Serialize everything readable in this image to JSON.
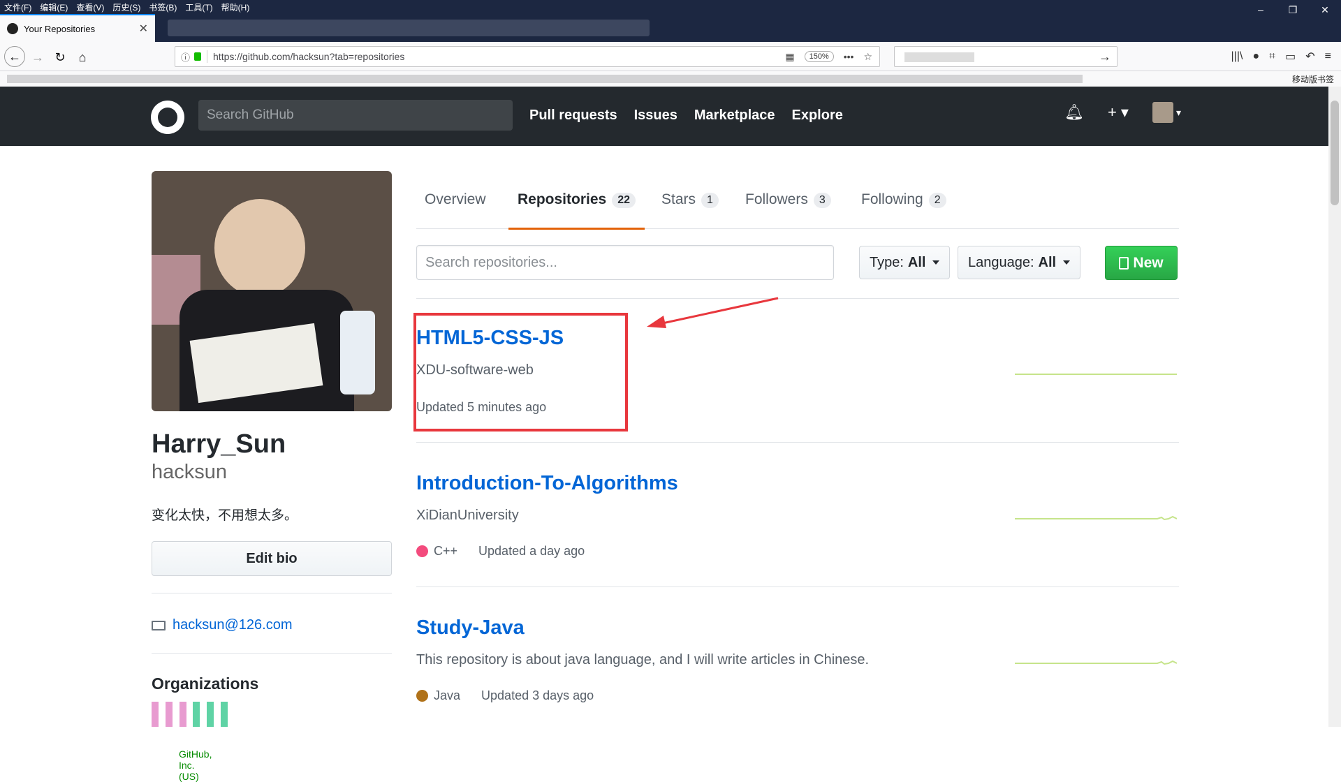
{
  "browser": {
    "menu": [
      "文件(F)",
      "编辑(E)",
      "查看(V)",
      "历史(S)",
      "书签(B)",
      "工具(T)",
      "帮助(H)"
    ],
    "tab_title": "Your Repositories",
    "identity": "GitHub, Inc. (US)",
    "url": "https://github.com/hacksun?tab=repositories",
    "zoom": "150%",
    "mobile_bookmarks": "移动版书签"
  },
  "github": {
    "search_placeholder": "Search GitHub",
    "nav": [
      "Pull requests",
      "Issues",
      "Marketplace",
      "Explore"
    ]
  },
  "profile": {
    "name": "Harry_Sun",
    "login": "hacksun",
    "bio": "变化太快，不用想太多。",
    "edit_bio": "Edit bio",
    "email": "hacksun@126.com",
    "organizations_title": "Organizations"
  },
  "tabs": [
    {
      "label": "Overview",
      "count": ""
    },
    {
      "label": "Repositories",
      "count": "22"
    },
    {
      "label": "Stars",
      "count": "1"
    },
    {
      "label": "Followers",
      "count": "3"
    },
    {
      "label": "Following",
      "count": "2"
    }
  ],
  "filters": {
    "search_placeholder": "Search repositories...",
    "type_label": "Type:",
    "type_value": "All",
    "language_label": "Language:",
    "language_value": "All",
    "new_label": "New"
  },
  "repos": [
    {
      "name": "HTML5-CSS-JS",
      "description": "XDU-software-web",
      "language": "",
      "language_color": "",
      "updated": "Updated 5 minutes ago"
    },
    {
      "name": "Introduction-To-Algorithms",
      "description": "XiDianUniversity",
      "language": "C++",
      "language_color": "#f34b7d",
      "updated": "Updated a day ago"
    },
    {
      "name": "Study-Java",
      "description": "This repository is about java language, and I will write articles in Chinese.",
      "language": "Java",
      "language_color": "#b07219",
      "updated": "Updated 3 days ago"
    }
  ],
  "colors": {
    "header_bg": "#24292e",
    "link": "#0366d6",
    "new_button": "#28a745",
    "active_tab_underline": "#e36209",
    "annotation": "#e8373d",
    "sparkline": "#c6e48b"
  }
}
